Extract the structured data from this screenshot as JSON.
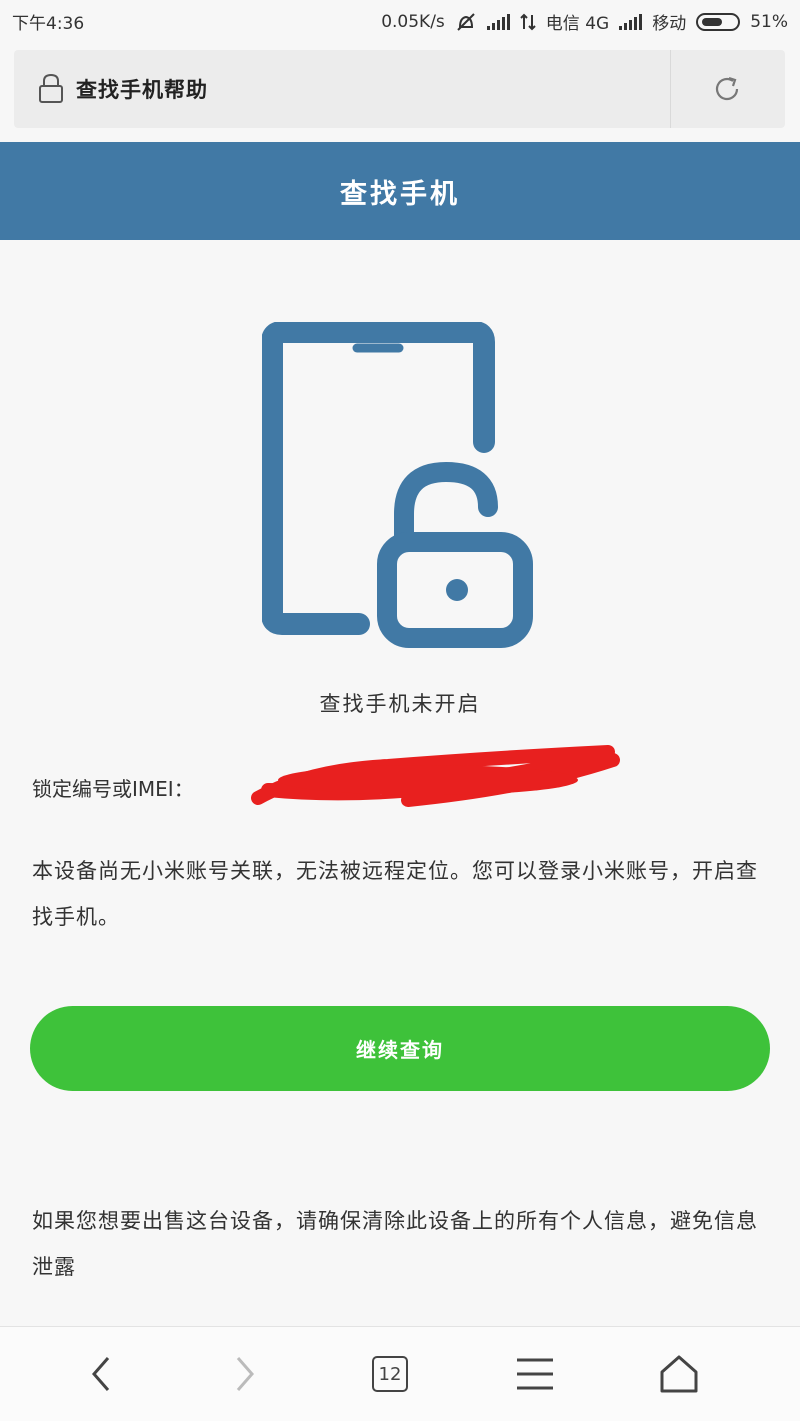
{
  "status_bar": {
    "time": "下午4:36",
    "net_speed": "0.05K/s",
    "carrier1": "电信 4G",
    "carrier2": "移动",
    "battery": "51%",
    "battery_level": 0.51
  },
  "address_bar": {
    "title": "查找手机帮助",
    "lock_icon": "lock-icon",
    "refresh_icon": "refresh-icon"
  },
  "header": {
    "title": "查找手机"
  },
  "main": {
    "illustration_icon": "phone-unlocked-icon",
    "status_title": "查找手机未开启",
    "imei_label": "锁定编号或IMEI：",
    "description": "本设备尚无小米账号关联，无法被远程定位。您可以登录小米账号，开启查找手机。",
    "continue_button": "继续查询",
    "sale_note": "如果您想要出售这台设备，请确保清除此设备上的所有个人信息，避免信息泄露"
  },
  "bottom_nav": {
    "tab_count": "12",
    "icons": [
      "back-icon",
      "forward-icon",
      "tabs-icon",
      "menu-icon",
      "home-icon"
    ]
  },
  "colors": {
    "header_blue": "#4179a5",
    "button_green": "#3ec23a",
    "redaction_red": "#e8201f"
  }
}
